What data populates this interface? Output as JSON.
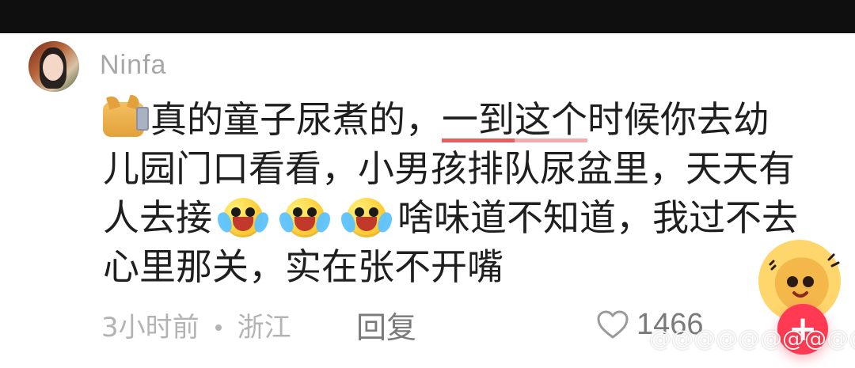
{
  "comment": {
    "username": "Ninfa",
    "lines": [
      {
        "t1": "真的童子尿煮的，",
        "hl1": "一到",
        "hl2": "这个",
        "t2": "时候你去幼"
      },
      {
        "t": "儿园门口看看，小男孩排队尿盆里，天天有"
      },
      {
        "t_before": "人去接",
        "t_after": "啥味道不知道，我过不去"
      },
      {
        "t": "心里那关，实在张不开嘴"
      }
    ]
  },
  "meta": {
    "time": "3小时前",
    "location": "浙江",
    "reply_label": "回复",
    "likes": "1466"
  },
  "icons": {
    "avatar": "user-avatar-icon",
    "cat_card_emoji": "cat-emoji-icon",
    "laugh_cry": "laugh-cry-emoji-icon",
    "like": "heart-icon",
    "add": "plus-icon"
  },
  "colors": {
    "topbar": "#0f0f0f",
    "username": "#a7a7a7",
    "comment_text": "#1f1f1f",
    "meta_text": "#b3b3b3",
    "like_text": "#7a7a7a",
    "plus_button": "#ff3a52",
    "highlight_red": "#e34d4d"
  },
  "watermark": {
    "text": "@@@@@@@@@@@"
  }
}
